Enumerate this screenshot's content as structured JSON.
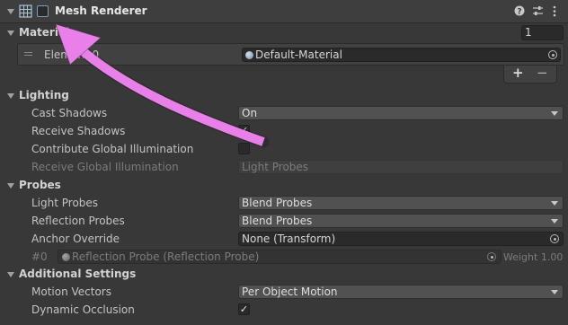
{
  "component": {
    "title": "Mesh Renderer",
    "enabled": false,
    "header_icons": [
      "grid-mesh-icon",
      "help-icon",
      "settings-sliders-icon",
      "more-vertical-icon"
    ]
  },
  "materials": {
    "title": "Materials",
    "size": "1",
    "element_label": "Element 0",
    "element_value": "Default-Material",
    "add": "+",
    "remove": "−"
  },
  "lighting": {
    "title": "Lighting",
    "cast_shadows": {
      "label": "Cast Shadows",
      "value": "On"
    },
    "receive_shadows": {
      "label": "Receive Shadows",
      "checked": true
    },
    "contribute_gi": {
      "label": "Contribute Global Illumination",
      "checked": false
    },
    "receive_gi": {
      "label": "Receive Global Illumination",
      "value": "Light Probes"
    }
  },
  "probes": {
    "title": "Probes",
    "light_probes": {
      "label": "Light Probes",
      "value": "Blend Probes"
    },
    "reflection_probes": {
      "label": "Reflection Probes",
      "value": "Blend Probes"
    },
    "anchor_override": {
      "label": "Anchor Override",
      "value": "None (Transform)"
    },
    "probe_row": {
      "index": "#0",
      "value": "Reflection Probe (Reflection Probe)",
      "weight": "Weight 1.00"
    }
  },
  "additional": {
    "title": "Additional Settings",
    "motion_vectors": {
      "label": "Motion Vectors",
      "value": "Per Object Motion"
    },
    "dynamic_occlusion": {
      "label": "Dynamic Occlusion",
      "checked": true
    }
  },
  "annotation": {
    "color": "#e97fe9",
    "shape": "curved-arrow"
  }
}
